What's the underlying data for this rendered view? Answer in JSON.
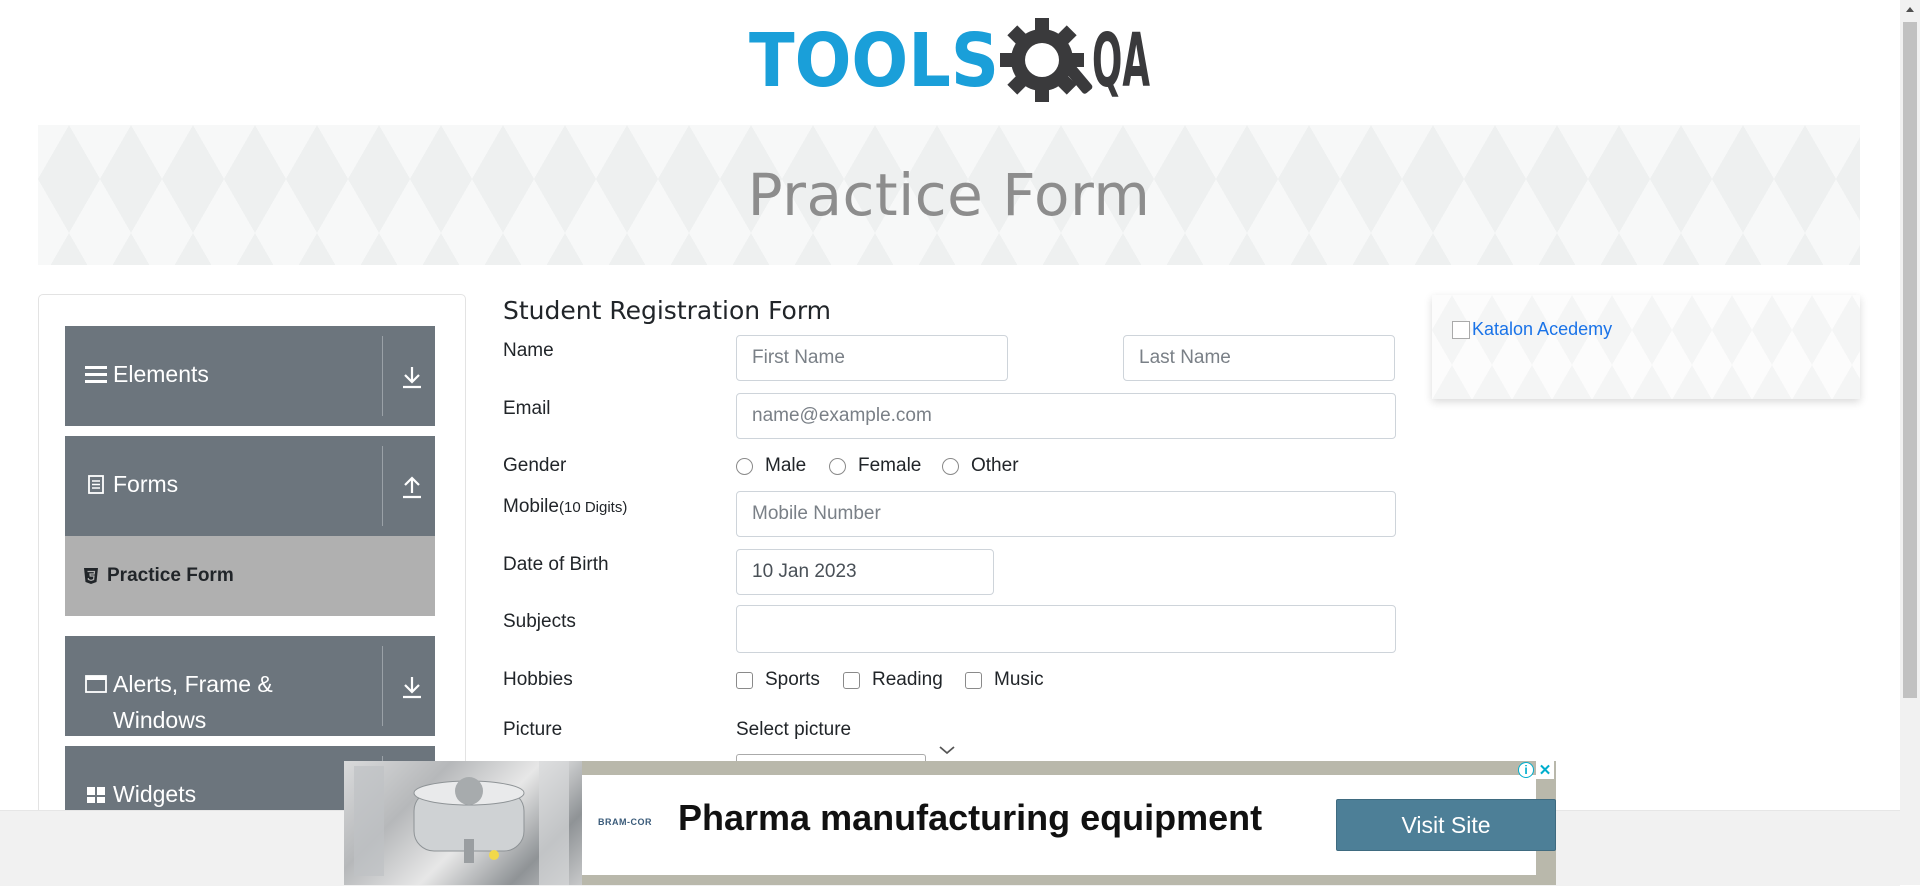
{
  "logo": {
    "text_left": "TOOLS",
    "text_right": "QA",
    "primary_color": "#1a9fd9",
    "dark_color": "#3a3a3c"
  },
  "banner": {
    "title": "Practice Form"
  },
  "sidebar": {
    "groups": [
      {
        "label": "Elements",
        "icon": "menu-icon",
        "arrow": "download-arrow-icon"
      },
      {
        "label": "Forms",
        "icon": "document-icon",
        "arrow": "upload-arrow-icon"
      },
      {
        "label": "Alerts, Frame & Windows",
        "label_line1": "Alerts, Frame &",
        "label_line2": "Windows",
        "icon": "window-icon",
        "arrow": "download-arrow-icon"
      },
      {
        "label": "Widgets",
        "icon": "widgets-icon"
      }
    ],
    "forms_items": [
      {
        "label": "Practice Form",
        "icon": "html5-icon",
        "active": true
      }
    ]
  },
  "form": {
    "title": "Student Registration Form",
    "name": {
      "label": "Name",
      "first_placeholder": "First Name",
      "last_placeholder": "Last Name"
    },
    "email": {
      "label": "Email",
      "placeholder": "name@example.com"
    },
    "gender": {
      "label": "Gender",
      "options": [
        "Male",
        "Female",
        "Other"
      ]
    },
    "mobile": {
      "label": "Mobile",
      "hint": "(10 Digits)",
      "placeholder": "Mobile Number"
    },
    "dob": {
      "label": "Date of Birth",
      "value": "10 Jan 2023"
    },
    "subjects": {
      "label": "Subjects",
      "value": ""
    },
    "hobbies": {
      "label": "Hobbies",
      "options": [
        "Sports",
        "Reading",
        "Music"
      ]
    },
    "picture": {
      "label": "Picture",
      "select_label": "Select picture"
    }
  },
  "side_ad": {
    "alt_text": "Katalon Acedemy"
  },
  "bottom_ad": {
    "brand": "BRAM-COR",
    "headline": "Pharma manufacturing equipment",
    "button": "Visit Site",
    "info_glyph": "i",
    "close_glyph": "✕"
  },
  "colors": {
    "sidebar_group": "#6c757d",
    "sidebar_active": "#b0b0b0",
    "ad_button": "#4d7f97",
    "link": "#1a73e8"
  }
}
